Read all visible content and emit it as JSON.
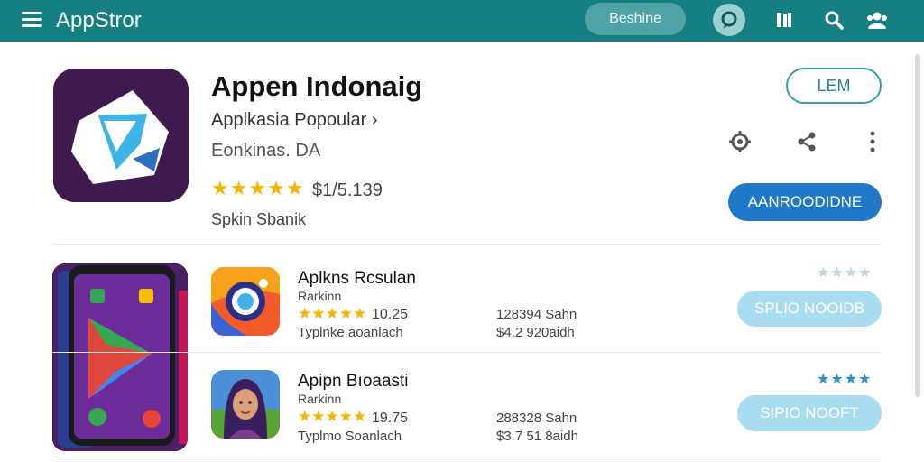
{
  "topbar": {
    "title": "AppStror",
    "pill_label": "Beshine",
    "icons": [
      "menu-icon",
      "chat-badge-icon",
      "library-icon",
      "search-icon",
      "account-icon"
    ],
    "color": "#157f83"
  },
  "hero": {
    "title": "Appen Indonaig",
    "subtitle": "Applkasia Popoular ›",
    "developer": "Eonkinas. DA",
    "stars": "★★★★★",
    "price": "$1/5.139",
    "size": "Spkin Sbanik",
    "lem_label": "LEM",
    "install_label": "AANROODIDNE",
    "action_icons": [
      "settings-icon",
      "share-icon",
      "more-vert-icon"
    ]
  },
  "list": [
    {
      "name": "Aplkns Rcsulan",
      "category": "Rarkinn",
      "stars": "★★★★★",
      "rating": "10.25",
      "tag": "Typlnke aoanlach",
      "downloads": "128394 Sahn",
      "price": "$4.2 920aidh",
      "mini_stars": "★★★★",
      "button_label": "SPLIO NOOIDB"
    },
    {
      "name": "Apipn Bıoaasti",
      "category": "Rarkinn",
      "stars": "★★★★★",
      "rating": "19.75",
      "tag": "Typlmo Soanlach",
      "downloads": "288328 Sahn",
      "price": "$3.7 51 8aidh",
      "mini_stars": "★★★★",
      "button_label": "SIPIO NOOFT"
    }
  ],
  "colors": {
    "accent": "#157f83",
    "install": "#1f78c8",
    "row_button": "#a9dcf0",
    "star": "#f4b400",
    "mini_star_light": "#bcd9ea",
    "mini_star_dark": "#2d8fc8"
  }
}
